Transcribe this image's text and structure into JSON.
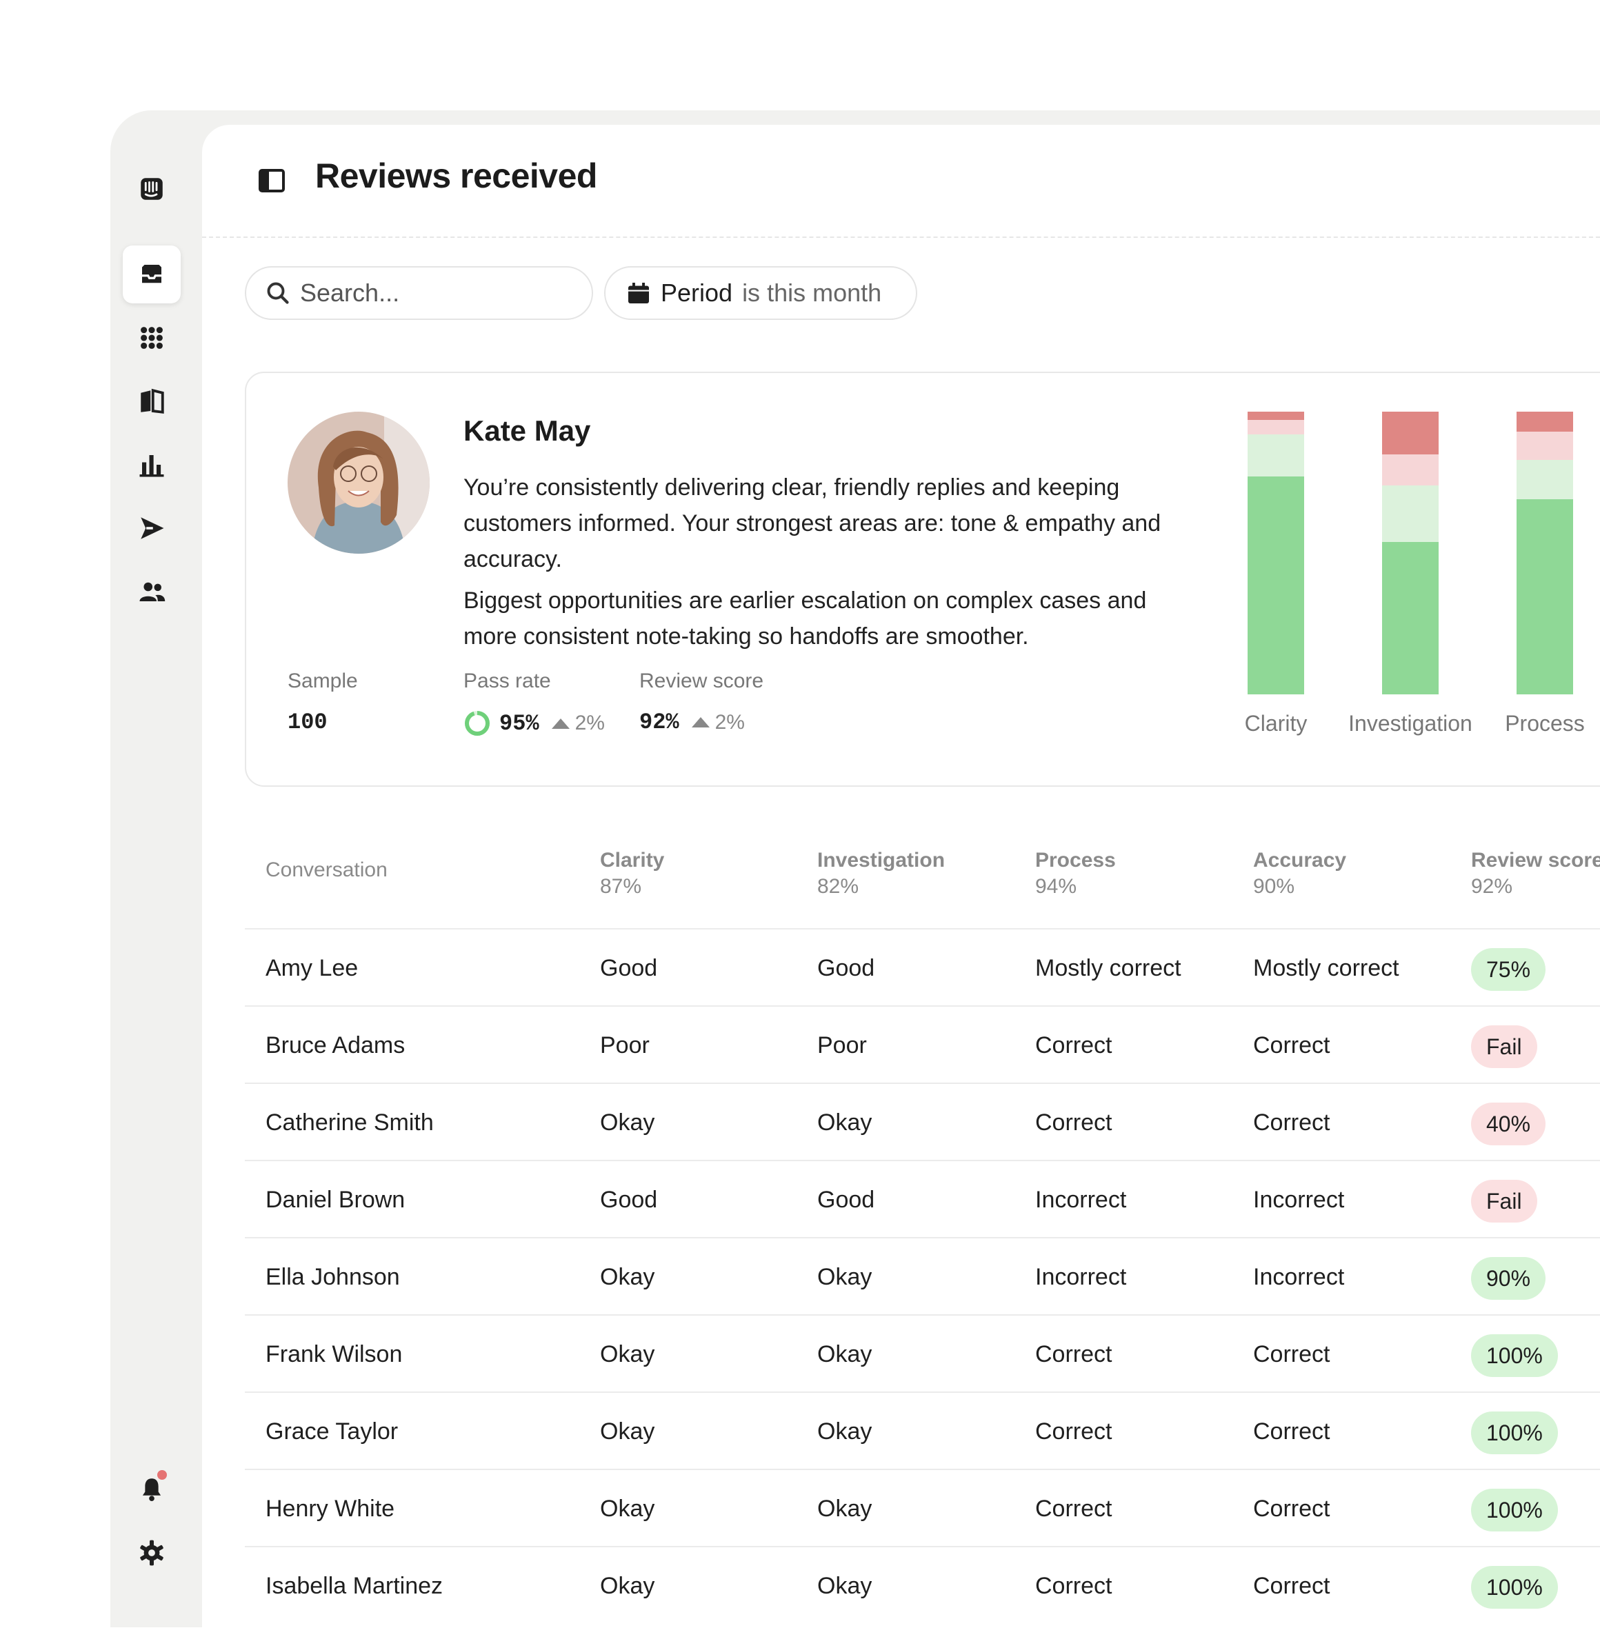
{
  "header": {
    "title": "Reviews received"
  },
  "search": {
    "placeholder": "Search..."
  },
  "filter": {
    "label": "Period",
    "value": "is this month"
  },
  "sidebar": {
    "items": [
      {
        "icon": "logo-icon"
      },
      {
        "icon": "inbox-icon",
        "active": true
      },
      {
        "icon": "apps-icon"
      },
      {
        "icon": "book-icon"
      },
      {
        "icon": "bar-chart-icon"
      },
      {
        "icon": "send-icon"
      },
      {
        "icon": "people-icon"
      }
    ],
    "bottom": [
      {
        "icon": "bell-icon",
        "notification": true
      },
      {
        "icon": "gear-icon"
      }
    ]
  },
  "profile": {
    "name": "Kate May",
    "summary": [
      "You’re consistently delivering clear, friendly replies and keeping customers informed. Your strongest areas are: tone & empathy and accuracy.",
      "Biggest opportunities are earlier escalation on complex cases and more consistent note-taking so handoffs are smoother."
    ],
    "stats": {
      "sample_label": "Sample",
      "sample_value": "100",
      "pass_rate_label": "Pass rate",
      "pass_rate_value": "95%",
      "pass_rate_delta": "2%",
      "pass_rate_fraction": 0.95,
      "review_score_label": "Review score",
      "review_score_value": "92%",
      "review_score_delta": "2%"
    }
  },
  "chart_data": {
    "type": "bar",
    "stacked": true,
    "categories": [
      "Clarity",
      "Investigation",
      "Process"
    ],
    "series": [
      {
        "color": "#8fd896",
        "values": [
          77,
          54,
          69
        ]
      },
      {
        "color": "#dcf2dc",
        "values": [
          15,
          20,
          14
        ]
      },
      {
        "color": "#f6d6d7",
        "values": [
          5,
          11,
          10
        ]
      },
      {
        "color": "#df8784",
        "values": [
          3,
          15,
          7
        ]
      }
    ],
    "ylim": [
      0,
      100
    ]
  },
  "colors": {
    "pass_pill": "#d6f4d6",
    "fail_pill": "#fbe0e1",
    "accent_green": "#6fd07a"
  },
  "table": {
    "columns": [
      {
        "label": "Conversation",
        "sub": ""
      },
      {
        "label": "Clarity",
        "sub": "87%"
      },
      {
        "label": "Investigation",
        "sub": "82%"
      },
      {
        "label": "Process",
        "sub": "94%"
      },
      {
        "label": "Accuracy",
        "sub": "90%"
      },
      {
        "label": "Review score",
        "sub": "92%"
      }
    ],
    "rows": [
      {
        "name": "Amy Lee",
        "clarity": "Good",
        "investigation": "Good",
        "process": "Mostly correct",
        "accuracy": "Mostly correct",
        "score": "75%",
        "status": "pass"
      },
      {
        "name": "Bruce Adams",
        "clarity": "Poor",
        "investigation": "Poor",
        "process": "Correct",
        "accuracy": "Correct",
        "score": "Fail",
        "status": "fail"
      },
      {
        "name": "Catherine Smith",
        "clarity": "Okay",
        "investigation": "Okay",
        "process": "Correct",
        "accuracy": "Correct",
        "score": "40%",
        "status": "fail"
      },
      {
        "name": "Daniel Brown",
        "clarity": "Good",
        "investigation": "Good",
        "process": "Incorrect",
        "accuracy": "Incorrect",
        "score": "Fail",
        "status": "fail"
      },
      {
        "name": "Ella Johnson",
        "clarity": "Okay",
        "investigation": "Okay",
        "process": "Incorrect",
        "accuracy": "Incorrect",
        "score": "90%",
        "status": "pass"
      },
      {
        "name": "Frank Wilson",
        "clarity": "Okay",
        "investigation": "Okay",
        "process": "Correct",
        "accuracy": "Correct",
        "score": "100%",
        "status": "pass"
      },
      {
        "name": "Grace Taylor",
        "clarity": "Okay",
        "investigation": "Okay",
        "process": "Correct",
        "accuracy": "Correct",
        "score": "100%",
        "status": "pass"
      },
      {
        "name": "Henry White",
        "clarity": "Okay",
        "investigation": "Okay",
        "process": "Correct",
        "accuracy": "Correct",
        "score": "100%",
        "status": "pass"
      },
      {
        "name": "Isabella Martinez",
        "clarity": "Okay",
        "investigation": "Okay",
        "process": "Correct",
        "accuracy": "Correct",
        "score": "100%",
        "status": "pass"
      }
    ]
  }
}
